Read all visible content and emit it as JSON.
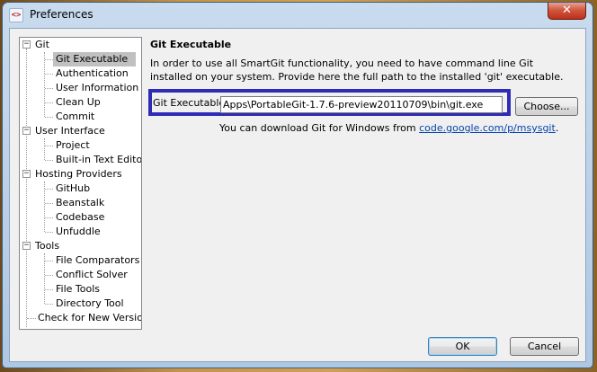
{
  "window": {
    "app_icon": "<>",
    "title": "Preferences",
    "close_glyph": "✕"
  },
  "tree": {
    "groups": [
      {
        "label": "Git",
        "expander": "−",
        "children": [
          "Git Executable",
          "Authentication",
          "User Information",
          "Clean Up",
          "Commit"
        ]
      },
      {
        "label": "User Interface",
        "expander": "−",
        "children": [
          "Project",
          "Built-in Text Editors"
        ]
      },
      {
        "label": "Hosting Providers",
        "expander": "−",
        "children": [
          "GitHub",
          "Beanstalk",
          "Codebase",
          "Unfuddle"
        ]
      },
      {
        "label": "Tools",
        "expander": "−",
        "children": [
          "File Comparators",
          "Conflict Solver",
          "File Tools",
          "Directory Tool"
        ]
      }
    ],
    "standalone": "Check for New Version",
    "selected": "Git Executable"
  },
  "panel": {
    "heading": "Git Executable",
    "description": "In order to use all SmartGit functionality, you need to have command line Git installed on your system. Provide here the full path to the installed 'git' executable.",
    "field_label": "Git Executable:",
    "field_value": "Apps\\PortableGit-1.7.6-preview20110709\\bin\\git.exe",
    "choose_label": "Choose...",
    "download_text": "You can download Git for Windows from ",
    "download_link": "code.google.com/p/msysgit",
    "download_suffix": "."
  },
  "buttons": {
    "ok": "OK",
    "cancel": "Cancel"
  },
  "colors": {
    "highlight_border": "#2f2bb7",
    "link": "#0645ad",
    "selection": "#c0c0c0"
  }
}
